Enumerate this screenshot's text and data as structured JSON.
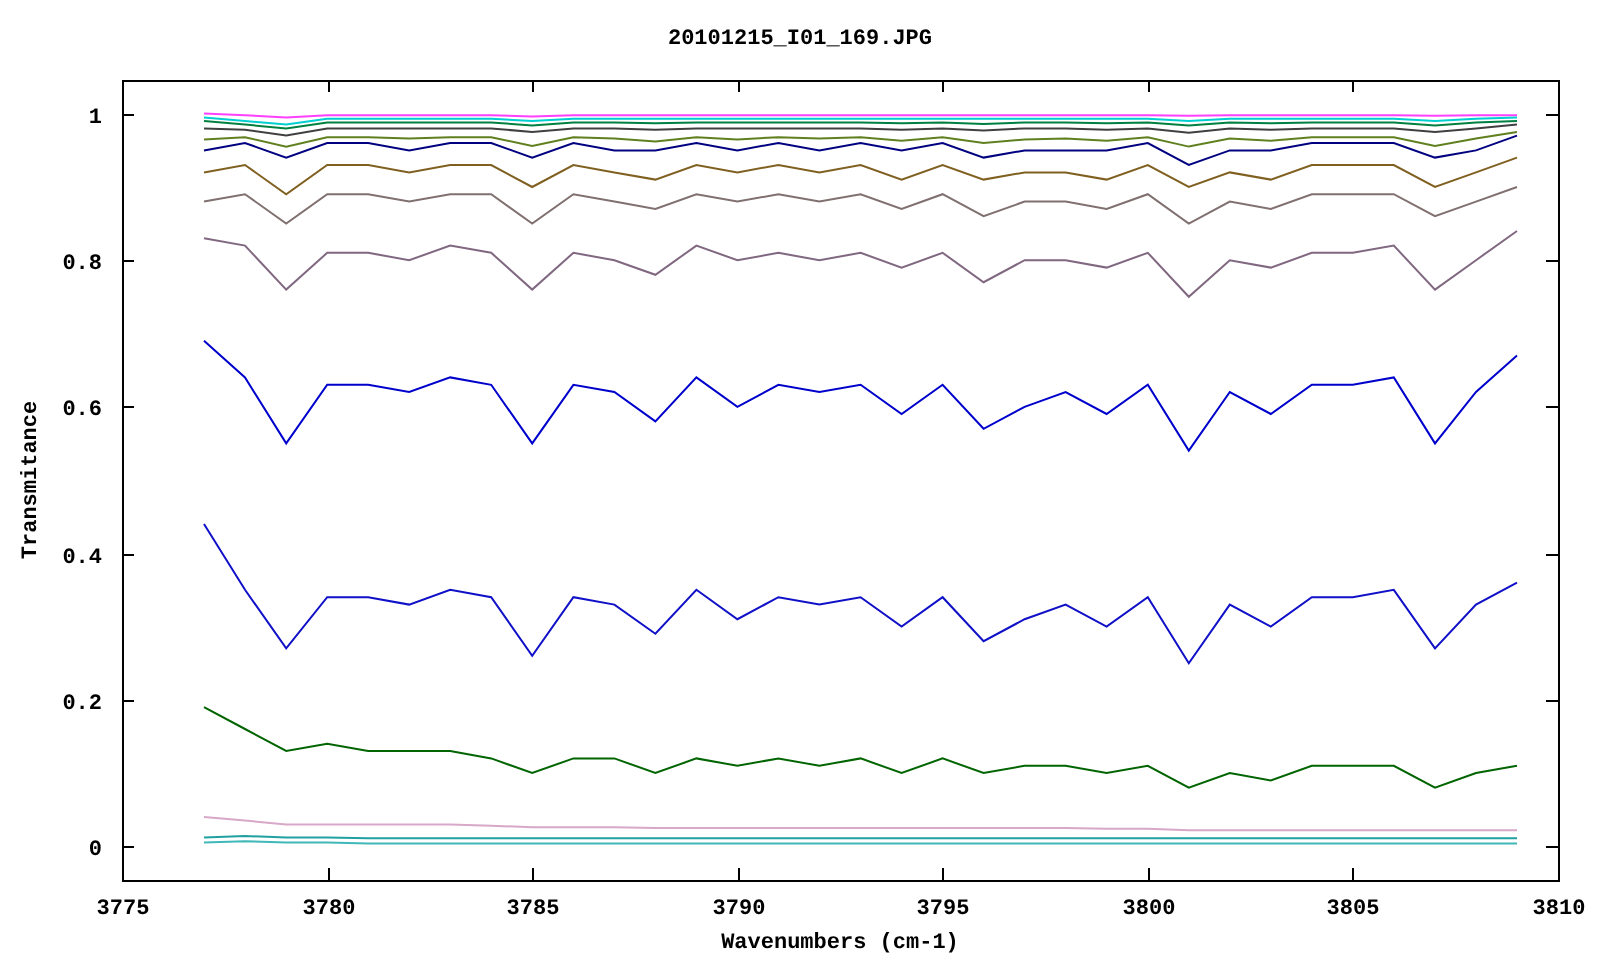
{
  "chart_data": {
    "type": "line",
    "title": "20101215_I01_169.JPG",
    "xlabel": "Wavenumbers (cm-1)",
    "ylabel": "Transmitance",
    "xlim": [
      3775,
      3810
    ],
    "ylim": [
      -0.046,
      1.046
    ],
    "xticks": [
      3775,
      3780,
      3785,
      3790,
      3795,
      3800,
      3805,
      3810
    ],
    "yticks": [
      0,
      0.2,
      0.4,
      0.6,
      0.8,
      1
    ],
    "x": [
      3777,
      3778,
      3779,
      3780,
      3781,
      3782,
      3783,
      3784,
      3785,
      3786,
      3787,
      3788,
      3789,
      3790,
      3791,
      3792,
      3793,
      3794,
      3795,
      3796,
      3797,
      3798,
      3799,
      3800,
      3801,
      3802,
      3803,
      3804,
      3805,
      3806,
      3807,
      3808,
      3809
    ],
    "series": [
      {
        "color": "#ff40ff",
        "values": [
          1.0,
          0.998,
          0.995,
          0.998,
          0.998,
          0.998,
          0.998,
          0.998,
          0.996,
          0.998,
          0.998,
          0.998,
          0.998,
          0.998,
          0.998,
          0.998,
          0.998,
          0.998,
          0.998,
          0.998,
          0.998,
          0.998,
          0.998,
          0.998,
          0.997,
          0.998,
          0.998,
          0.998,
          0.998,
          0.998,
          0.997,
          0.998,
          0.998
        ]
      },
      {
        "color": "#00d0d0",
        "values": [
          0.995,
          0.99,
          0.985,
          0.993,
          0.993,
          0.993,
          0.993,
          0.993,
          0.99,
          0.993,
          0.993,
          0.993,
          0.993,
          0.993,
          0.993,
          0.993,
          0.993,
          0.993,
          0.993,
          0.993,
          0.993,
          0.993,
          0.993,
          0.993,
          0.99,
          0.993,
          0.993,
          0.993,
          0.993,
          0.993,
          0.99,
          0.993,
          0.995
        ]
      },
      {
        "color": "#008040",
        "values": [
          0.99,
          0.985,
          0.98,
          0.988,
          0.988,
          0.988,
          0.988,
          0.988,
          0.984,
          0.988,
          0.988,
          0.987,
          0.988,
          0.988,
          0.988,
          0.988,
          0.988,
          0.987,
          0.988,
          0.986,
          0.988,
          0.988,
          0.987,
          0.988,
          0.984,
          0.988,
          0.987,
          0.988,
          0.988,
          0.988,
          0.984,
          0.988,
          0.99
        ]
      },
      {
        "color": "#404040",
        "values": [
          0.98,
          0.978,
          0.97,
          0.98,
          0.98,
          0.98,
          0.98,
          0.98,
          0.975,
          0.98,
          0.98,
          0.978,
          0.98,
          0.98,
          0.98,
          0.98,
          0.98,
          0.978,
          0.98,
          0.977,
          0.98,
          0.98,
          0.978,
          0.98,
          0.974,
          0.98,
          0.978,
          0.98,
          0.98,
          0.98,
          0.975,
          0.98,
          0.985
        ]
      },
      {
        "color": "#608020",
        "values": [
          0.965,
          0.968,
          0.955,
          0.968,
          0.968,
          0.966,
          0.968,
          0.968,
          0.956,
          0.968,
          0.966,
          0.962,
          0.968,
          0.965,
          0.968,
          0.966,
          0.968,
          0.963,
          0.968,
          0.96,
          0.965,
          0.966,
          0.963,
          0.968,
          0.955,
          0.966,
          0.963,
          0.968,
          0.968,
          0.968,
          0.956,
          0.966,
          0.975
        ]
      },
      {
        "color": "#000080",
        "values": [
          0.95,
          0.96,
          0.94,
          0.96,
          0.96,
          0.95,
          0.96,
          0.96,
          0.94,
          0.96,
          0.95,
          0.95,
          0.96,
          0.95,
          0.96,
          0.95,
          0.96,
          0.95,
          0.96,
          0.94,
          0.95,
          0.95,
          0.95,
          0.96,
          0.93,
          0.95,
          0.95,
          0.96,
          0.96,
          0.96,
          0.94,
          0.95,
          0.97
        ]
      },
      {
        "color": "#806020",
        "values": [
          0.92,
          0.93,
          0.89,
          0.93,
          0.93,
          0.92,
          0.93,
          0.93,
          0.9,
          0.93,
          0.92,
          0.91,
          0.93,
          0.92,
          0.93,
          0.92,
          0.93,
          0.91,
          0.93,
          0.91,
          0.92,
          0.92,
          0.91,
          0.93,
          0.9,
          0.92,
          0.91,
          0.93,
          0.93,
          0.93,
          0.9,
          0.92,
          0.94
        ]
      },
      {
        "color": "#807070",
        "values": [
          0.88,
          0.89,
          0.85,
          0.89,
          0.89,
          0.88,
          0.89,
          0.89,
          0.85,
          0.89,
          0.88,
          0.87,
          0.89,
          0.88,
          0.89,
          0.88,
          0.89,
          0.87,
          0.89,
          0.86,
          0.88,
          0.88,
          0.87,
          0.89,
          0.85,
          0.88,
          0.87,
          0.89,
          0.89,
          0.89,
          0.86,
          0.88,
          0.9
        ]
      },
      {
        "color": "#806880",
        "values": [
          0.83,
          0.82,
          0.76,
          0.81,
          0.81,
          0.8,
          0.82,
          0.81,
          0.76,
          0.81,
          0.8,
          0.78,
          0.82,
          0.8,
          0.81,
          0.8,
          0.81,
          0.79,
          0.81,
          0.77,
          0.8,
          0.8,
          0.79,
          0.81,
          0.75,
          0.8,
          0.79,
          0.81,
          0.81,
          0.82,
          0.76,
          0.8,
          0.84
        ]
      },
      {
        "color": "#0000cc",
        "values": [
          0.69,
          0.64,
          0.55,
          0.63,
          0.63,
          0.62,
          0.64,
          0.63,
          0.55,
          0.63,
          0.62,
          0.58,
          0.64,
          0.6,
          0.63,
          0.62,
          0.63,
          0.59,
          0.63,
          0.57,
          0.6,
          0.62,
          0.59,
          0.63,
          0.54,
          0.62,
          0.59,
          0.63,
          0.63,
          0.64,
          0.55,
          0.62,
          0.67
        ]
      },
      {
        "color": "#1010c8",
        "values": [
          0.44,
          0.35,
          0.27,
          0.34,
          0.34,
          0.33,
          0.35,
          0.34,
          0.26,
          0.34,
          0.33,
          0.29,
          0.35,
          0.31,
          0.34,
          0.33,
          0.34,
          0.3,
          0.34,
          0.28,
          0.31,
          0.33,
          0.3,
          0.34,
          0.25,
          0.33,
          0.3,
          0.34,
          0.34,
          0.35,
          0.27,
          0.33,
          0.36
        ]
      },
      {
        "color": "#006400",
        "values": [
          0.19,
          0.16,
          0.13,
          0.14,
          0.13,
          0.13,
          0.13,
          0.12,
          0.1,
          0.12,
          0.12,
          0.1,
          0.12,
          0.11,
          0.12,
          0.11,
          0.12,
          0.1,
          0.12,
          0.1,
          0.11,
          0.11,
          0.1,
          0.11,
          0.08,
          0.1,
          0.09,
          0.11,
          0.11,
          0.11,
          0.08,
          0.1,
          0.11
        ]
      },
      {
        "color": "#d8a8c8",
        "values": [
          0.04,
          0.035,
          0.03,
          0.03,
          0.03,
          0.03,
          0.03,
          0.028,
          0.026,
          0.026,
          0.026,
          0.025,
          0.025,
          0.025,
          0.025,
          0.025,
          0.025,
          0.025,
          0.025,
          0.025,
          0.025,
          0.025,
          0.024,
          0.024,
          0.022,
          0.022,
          0.022,
          0.022,
          0.022,
          0.022,
          0.022,
          0.022,
          0.022
        ]
      },
      {
        "color": "#20a0a0",
        "values": [
          0.012,
          0.014,
          0.012,
          0.012,
          0.011,
          0.011,
          0.011,
          0.011,
          0.011,
          0.011,
          0.011,
          0.011,
          0.011,
          0.011,
          0.011,
          0.011,
          0.011,
          0.011,
          0.011,
          0.011,
          0.011,
          0.011,
          0.011,
          0.011,
          0.011,
          0.011,
          0.011,
          0.011,
          0.011,
          0.011,
          0.011,
          0.011,
          0.011
        ]
      },
      {
        "color": "#40b8b8",
        "values": [
          0.005,
          0.007,
          0.005,
          0.005,
          0.004,
          0.004,
          0.004,
          0.004,
          0.004,
          0.004,
          0.004,
          0.004,
          0.004,
          0.004,
          0.004,
          0.004,
          0.004,
          0.004,
          0.004,
          0.004,
          0.004,
          0.004,
          0.004,
          0.004,
          0.004,
          0.004,
          0.004,
          0.004,
          0.004,
          0.004,
          0.004,
          0.004,
          0.004
        ]
      }
    ]
  }
}
